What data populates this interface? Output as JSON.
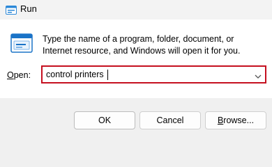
{
  "window": {
    "title": "Run",
    "title_icon": "run-window-icon"
  },
  "content": {
    "icon": "run-icon",
    "description": "Type the name of a program, folder, document, or Internet resource, and Windows will open it for you.",
    "open_label_prefix": "",
    "open_label_accel": "O",
    "open_label_rest": "pen:",
    "open_value": "control printers"
  },
  "buttons": {
    "ok": "OK",
    "cancel": "Cancel",
    "browse_accel": "B",
    "browse_rest": "rowse..."
  },
  "colors": {
    "focus_border": "#c50f1f",
    "accent_icon": "#0078d4"
  }
}
